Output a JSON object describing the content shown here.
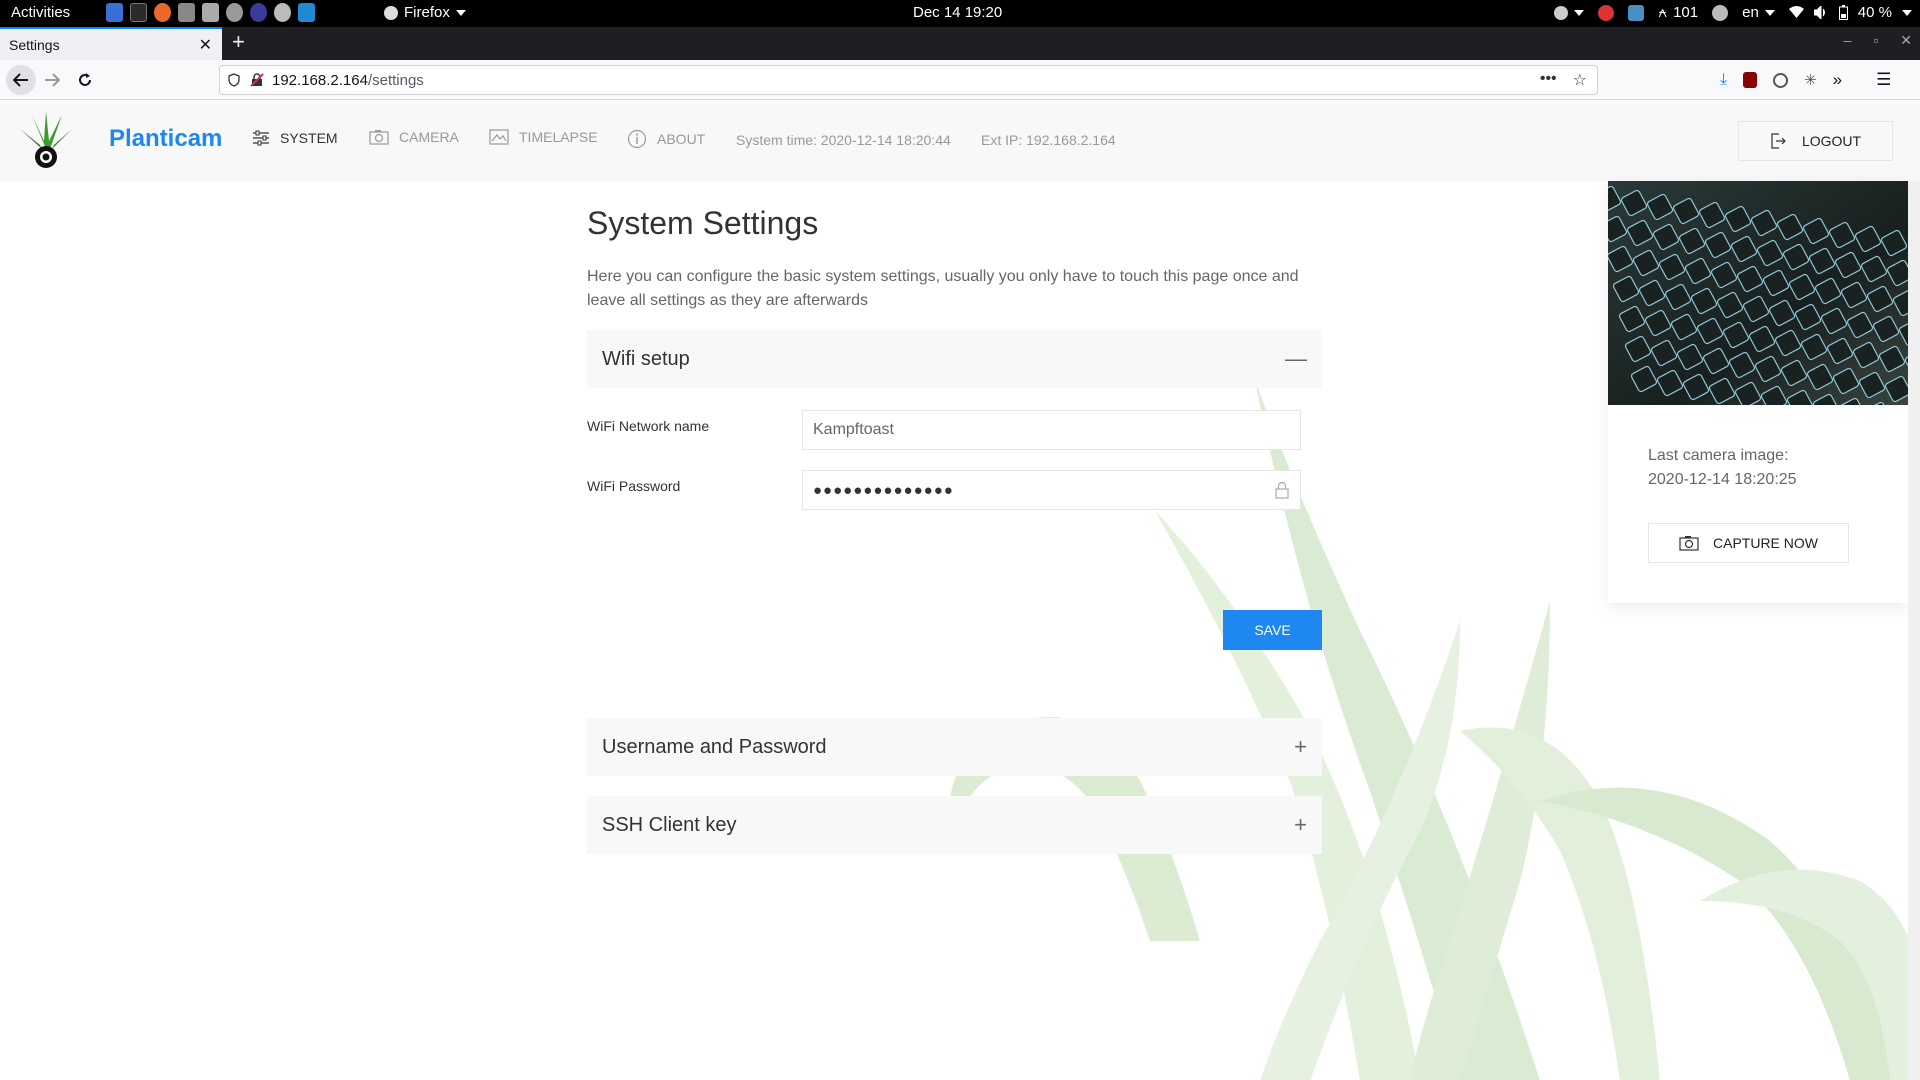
{
  "gnome": {
    "activities": "Activities",
    "app_menu": "Firefox",
    "clock": "Dec 14  19:20",
    "tray_counter": "101",
    "lang": "en",
    "battery": "40 %"
  },
  "browser": {
    "tab_title": "Settings",
    "url_host": "192.168.2.164",
    "url_path": "/settings"
  },
  "app": {
    "brand": "Planticam",
    "nav": [
      {
        "label": "SYSTEM",
        "icon": "sliders-icon"
      },
      {
        "label": "CAMERA",
        "icon": "camera-icon"
      },
      {
        "label": "TIMELAPSE",
        "icon": "image-icon"
      },
      {
        "label": "ABOUT",
        "icon": "info-icon"
      }
    ],
    "system_time": "System time: 2020-12-14 18:20:44",
    "ext_ip": "Ext IP: 192.168.2.164",
    "logout_label": "LOGOUT"
  },
  "settings": {
    "title": "System Settings",
    "intro": "Here you can configure the basic system settings, usually you only have to touch this page once and leave all settings as they are afterwards",
    "sections": [
      {
        "title": "Wifi setup",
        "state": "expanded"
      },
      {
        "title": "Username and Password",
        "state": "collapsed"
      },
      {
        "title": "SSH Client key",
        "state": "collapsed"
      }
    ],
    "wifi": {
      "network_label": "WiFi Network name",
      "network_value": "Kampftoast",
      "password_label": "WiFi Password",
      "password_value": "●●●●●●●●●●●●●●",
      "save_label": "SAVE"
    }
  },
  "camera": {
    "caption_line1": "Last camera image:",
    "caption_line2": "2020-12-14 18:20:25",
    "capture_label": "CAPTURE NOW"
  },
  "colors": {
    "primary": "#1e87f0",
    "header_bg": "#f8f8f8",
    "plant_green": "#cfe3c4"
  }
}
